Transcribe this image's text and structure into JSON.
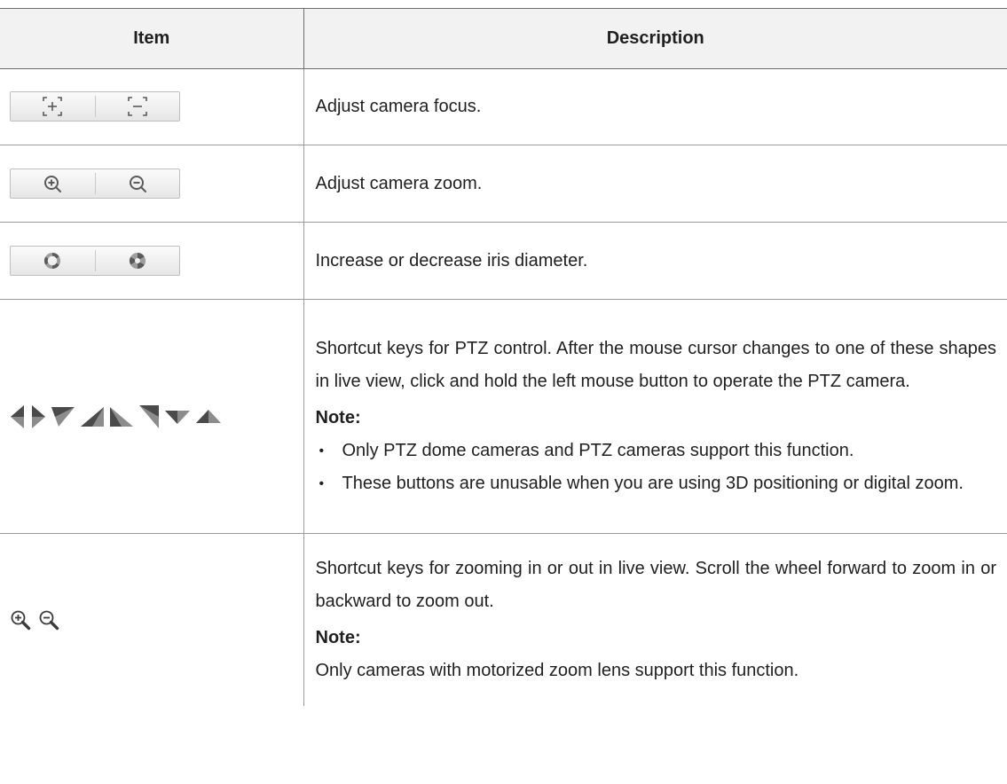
{
  "table": {
    "headers": {
      "item": "Item",
      "description": "Description"
    },
    "rows": [
      {
        "icons": [
          "focus-near-icon",
          "focus-far-icon"
        ],
        "description": "Adjust camera focus."
      },
      {
        "icons": [
          "zoom-in-icon",
          "zoom-out-icon"
        ],
        "description": "Adjust camera zoom."
      },
      {
        "icons": [
          "iris-open-icon",
          "iris-close-icon"
        ],
        "description": "Increase or decrease iris diameter."
      },
      {
        "icons": [
          "arrow-left-icon",
          "arrow-right-icon",
          "arrow-up-left-icon",
          "arrow-up-right-icon",
          "arrow-down-right-icon",
          "arrow-down-left-icon",
          "arrow-down-icon",
          "arrow-up-icon"
        ],
        "description": "Shortcut keys for PTZ control. After the mouse cursor changes to one of these shapes in live view, click and hold the left mouse button to operate the PTZ camera.",
        "note_label": "Note:",
        "note_bullets": [
          "Only PTZ dome cameras and PTZ cameras support this function.",
          "These buttons are unusable when you are using 3D positioning or digital zoom."
        ]
      },
      {
        "icons": [
          "magnifier-zoom-in-icon",
          "magnifier-zoom-out-icon"
        ],
        "description": "Shortcut keys for zooming in or out in live view. Scroll the wheel forward to zoom in or backward to zoom out.",
        "note_label": "Note:",
        "note_text": "Only cameras with motorized zoom lens support this function."
      }
    ]
  },
  "colors": {
    "header_bg": "#f2f2f2",
    "border": "#6f6f6f",
    "icon": "#5a5a5a",
    "arrow_dark": "#4a4a4a",
    "arrow_light": "#8c8c8c"
  }
}
